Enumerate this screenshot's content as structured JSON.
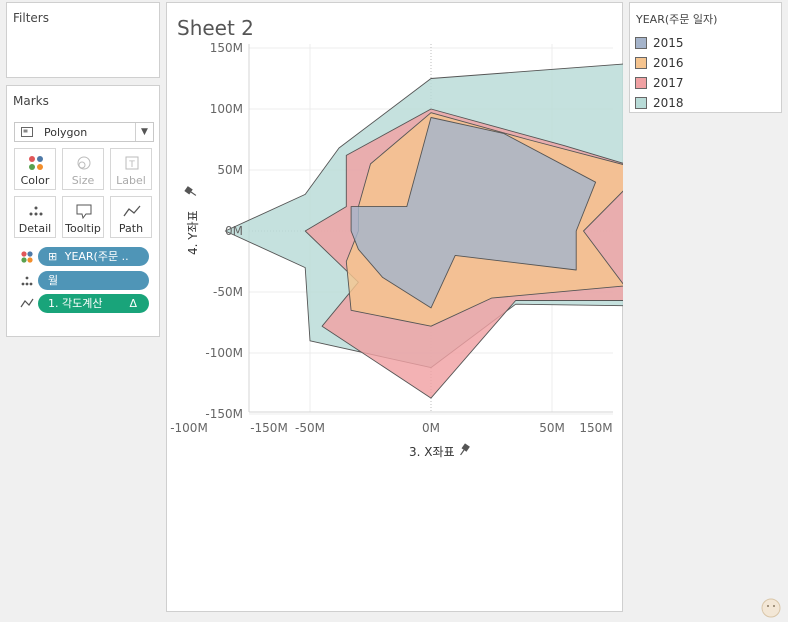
{
  "filters": {
    "title": "Filters"
  },
  "marks": {
    "title": "Marks",
    "mark_type": "Polygon",
    "cards": [
      {
        "label": "Color",
        "icon": "color-dots-icon",
        "enabled": true
      },
      {
        "label": "Size",
        "icon": "size-icon",
        "enabled": false
      },
      {
        "label": "Label",
        "icon": "label-icon",
        "enabled": false
      },
      {
        "label": "Detail",
        "icon": "detail-dots-icon",
        "enabled": true
      },
      {
        "label": "Tooltip",
        "icon": "tooltip-icon",
        "enabled": true
      },
      {
        "label": "Path",
        "icon": "path-icon",
        "enabled": true
      }
    ],
    "shelf": [
      {
        "icon": "color-dots-icon",
        "prefix": "⊞",
        "text": "YEAR(주문 ..",
        "color": "#4f95b7"
      },
      {
        "icon": "detail-dots-icon",
        "prefix": "",
        "text": "월",
        "color": "#4f95b7"
      },
      {
        "icon": "path-icon",
        "prefix": "",
        "text": "1. 각도계산",
        "suffix": "Δ",
        "color": "#19a47a"
      }
    ]
  },
  "sheet": {
    "title": "Sheet 2"
  },
  "legend": {
    "title": "YEAR(주문 일자)",
    "items": [
      {
        "label": "2015",
        "color": "#a5b4cb"
      },
      {
        "label": "2016",
        "color": "#f5c48f"
      },
      {
        "label": "2017",
        "color": "#f0a1a3"
      },
      {
        "label": "2018",
        "color": "#b8dbd7"
      }
    ]
  },
  "chart_data": {
    "type": "area",
    "subtype": "radar-polygon",
    "xlabel": "3. X좌표",
    "ylabel": "4. Y좌표",
    "xlim": [
      -150,
      150
    ],
    "ylim": [
      -150,
      150
    ],
    "unit": "M",
    "x_ticks": [
      "-150M",
      "-100M",
      "-50M",
      "0M",
      "50M",
      "100M",
      "150M"
    ],
    "y_ticks": [
      "150M",
      "100M",
      "50M",
      "0M",
      "-50M",
      "-100M",
      "-150M"
    ],
    "x_tick_values": [
      -150,
      -100,
      -50,
      0,
      50,
      100,
      150
    ],
    "y_tick_values": [
      150,
      100,
      50,
      0,
      -50,
      -100,
      -150
    ],
    "grid": true,
    "legend_position": "right",
    "series": [
      {
        "name": "2018",
        "color": "#b8dbd7",
        "points": [
          [
            0,
            125
          ],
          [
            80,
            137
          ],
          [
            125,
            73
          ],
          [
            115,
            0
          ],
          [
            108,
            -62
          ],
          [
            35,
            -60
          ],
          [
            0,
            -112
          ],
          [
            -50,
            -90
          ],
          [
            -52,
            -30
          ],
          [
            -85,
            0
          ],
          [
            -52,
            30
          ],
          [
            -38,
            68
          ]
        ]
      },
      {
        "name": "2017",
        "color": "#f0a1a3",
        "points": [
          [
            0,
            100
          ],
          [
            55,
            70
          ],
          [
            92,
            48
          ],
          [
            100,
            0
          ],
          [
            100,
            -57
          ],
          [
            35,
            -57
          ],
          [
            0,
            -137
          ],
          [
            -45,
            -78
          ],
          [
            -30,
            -42
          ],
          [
            -52,
            0
          ],
          [
            -35,
            20
          ],
          [
            -35,
            62
          ]
        ]
      },
      {
        "name": "2016",
        "color": "#f5c48f",
        "points": [
          [
            0,
            97
          ],
          [
            40,
            75
          ],
          [
            88,
            50
          ],
          [
            63,
            0
          ],
          [
            80,
            -45
          ],
          [
            25,
            -55
          ],
          [
            0,
            -78
          ],
          [
            -33,
            -65
          ],
          [
            -35,
            -25
          ],
          [
            -30,
            0
          ],
          [
            -30,
            20
          ],
          [
            -25,
            55
          ]
        ]
      },
      {
        "name": "2015",
        "color": "#a5b4cb",
        "points": [
          [
            0,
            93
          ],
          [
            30,
            80
          ],
          [
            68,
            40
          ],
          [
            60,
            0
          ],
          [
            60,
            -32
          ],
          [
            10,
            -20
          ],
          [
            0,
            -63
          ],
          [
            -20,
            -38
          ],
          [
            -30,
            -15
          ],
          [
            -33,
            0
          ],
          [
            -33,
            20
          ],
          [
            -10,
            20
          ]
        ]
      }
    ]
  }
}
